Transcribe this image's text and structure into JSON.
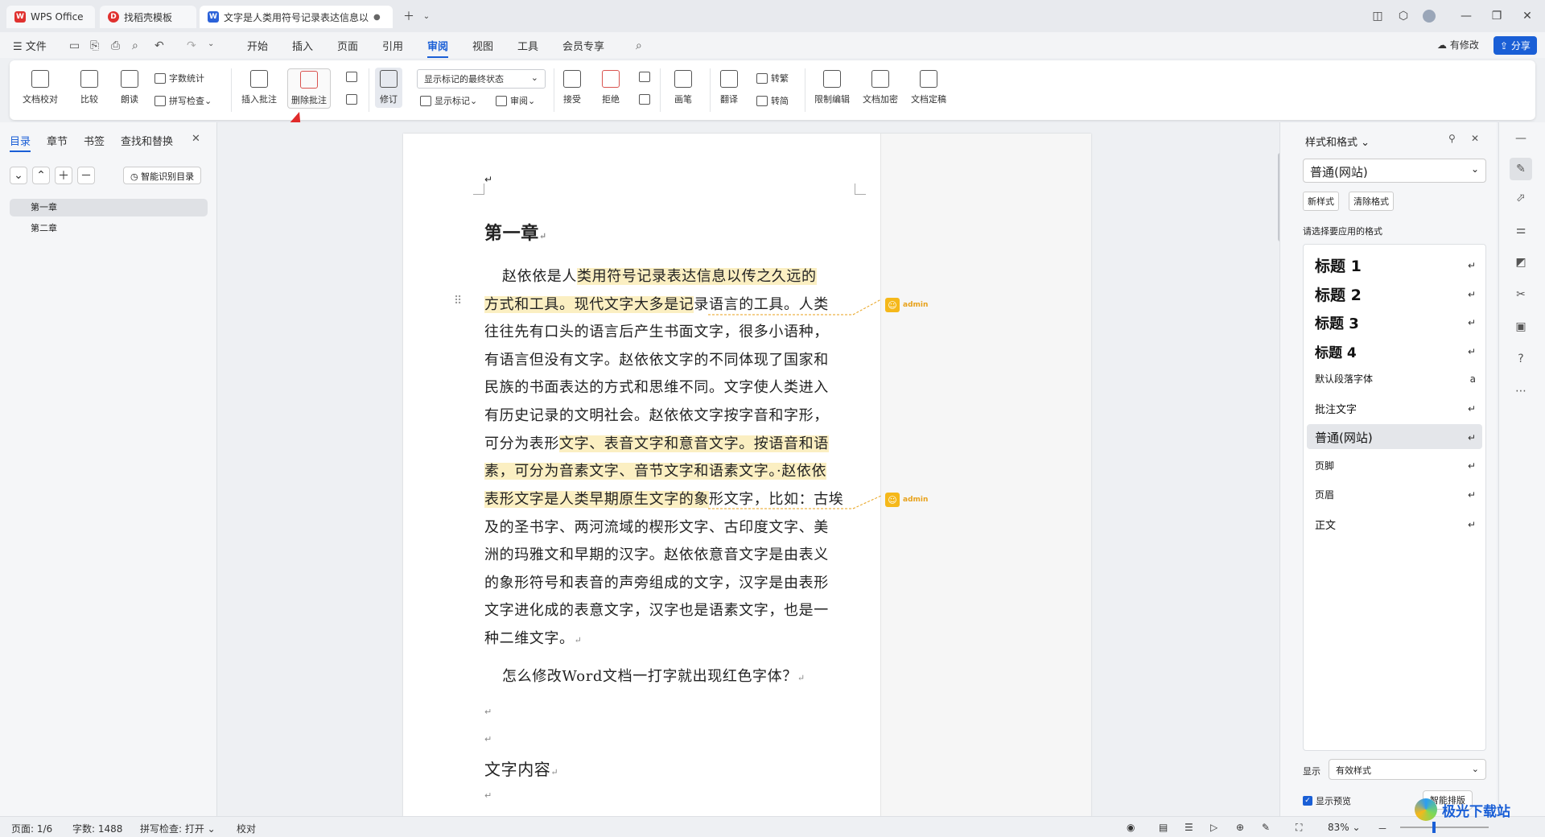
{
  "tabs": [
    {
      "label": "WPS Office",
      "icon": "wps-logo-icon"
    },
    {
      "label": "找稻壳模板",
      "icon": "docer-icon"
    },
    {
      "label": "文字是人类用符号记录表达信息以",
      "icon": "word-doc-icon"
    }
  ],
  "menu": {
    "file": "文件",
    "items": [
      "开始",
      "插入",
      "页面",
      "引用",
      "审阅",
      "视图",
      "工具",
      "会员专享"
    ],
    "active": "审阅",
    "has_changes": "有修改",
    "share": "分享"
  },
  "ribbon": {
    "doc_proof": "文档校对",
    "compare": "比较",
    "read_aloud": "朗读",
    "word_count": "字数统计",
    "spell_check": "拼写检查",
    "insert_comment": "插入批注",
    "delete_comment": "删除批注",
    "track": "修订",
    "markup_mode": "显示标记的最终状态",
    "show_markup": "显示标记",
    "review": "审阅",
    "accept": "接受",
    "reject": "拒绝",
    "ink": "画笔",
    "translate": "翻译",
    "to_traditional": "转繁",
    "to_simplified": "转简",
    "restrict_edit": "限制编辑",
    "encrypt": "文档加密",
    "finalize": "文档定稿"
  },
  "leftpane": {
    "tabs": [
      "目录",
      "章节",
      "书签",
      "查找和替换"
    ],
    "smart_toc": "智能识别目录",
    "toc_items": [
      "第一章",
      "第二章"
    ]
  },
  "document": {
    "heading": "第一章",
    "lines": [
      "赵依依是人类用符号记录表达信息以传之久远的",
      "方式和工具。现代文字大多是记录语言的工具。人类",
      "往往先有口头的语言后产生书面文字，很多小语种，",
      "有语言但没有文字。赵依依文字的不同体现了国家和",
      "民族的书面表达的方式和思维不同。文字使人类进入",
      "有历史记录的文明社会。赵依依文字按字音和字形，",
      "可分为表形文字、表音文字和意音文字。按语音和语",
      "素，可分为音素文字、音节文字和语素文字。·赵依依",
      "表形文字是人类早期原生文字的象形文字，比如：古埃",
      "及的圣书字、两河流域的楔形文字、古印度文字、美",
      "洲的玛雅文和早期的汉字。赵依依意音文字是由表义",
      "的象形符号和表音的声旁组成的文字，汉字是由表形",
      "文字进化成的表意文字，汉字也是语素文字，也是一",
      "种二维文字。"
    ],
    "question": "怎么修改Word文档一打字就出现红色字体？",
    "sub_heading": "文字内容",
    "comment_author": "admin"
  },
  "rightpane": {
    "title": "样式和格式",
    "current_style": "普通(网站)",
    "new_style": "新样式",
    "clear_format": "清除格式",
    "prompt": "请选择要应用的格式",
    "styles": [
      "标题 1",
      "标题 2",
      "标题 3",
      "标题 4",
      "默认段落字体",
      "批注文字",
      "普通(网站)",
      "页脚",
      "页眉",
      "正文"
    ],
    "show_label": "显示",
    "show_value": "有效样式",
    "preview": "显示预览",
    "smart_layout": "智能排版"
  },
  "status": {
    "page": "页面: 1/6",
    "words": "字数: 1488",
    "spell": "拼写检查: 打开",
    "proof": "校对",
    "zoom": "83%"
  },
  "watermark": "极光下载站",
  "accent": "#1a5fd6"
}
